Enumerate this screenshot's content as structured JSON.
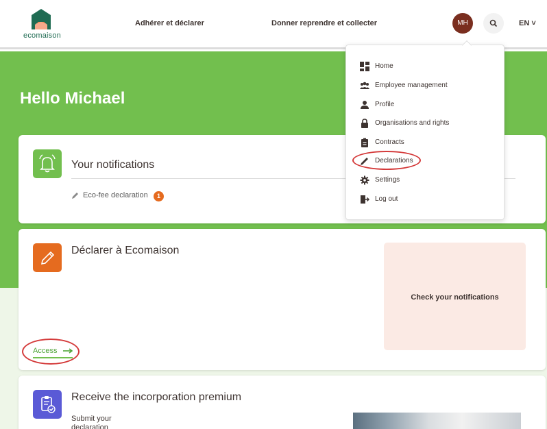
{
  "header": {
    "logo_text": "ecomaison",
    "nav": [
      "Adhérer et déclarer",
      "Donner reprendre et collecter"
    ],
    "avatar_initials": "MH",
    "language": "EN ˅"
  },
  "hero": {
    "greeting": "Hello Michael"
  },
  "notifications": {
    "title": "Your notifications",
    "item_label": "Eco-fee declaration",
    "item_count": "1"
  },
  "declare": {
    "title": "Déclarer à Ecomaison",
    "panel_text": "Check your notifications",
    "access_label": "Access"
  },
  "premium": {
    "title": "Receive the incorporation premium",
    "text_line1": "Submit your",
    "text_line2": "declaration"
  },
  "menu": {
    "items": [
      {
        "label": "Home",
        "icon": "grid-icon"
      },
      {
        "label": "Employee management",
        "icon": "users-icon"
      },
      {
        "label": "Profile",
        "icon": "user-icon"
      },
      {
        "label": "Organisations and rights",
        "icon": "lock-icon"
      },
      {
        "label": "Contracts",
        "icon": "clipboard-icon"
      },
      {
        "label": "Declarations",
        "icon": "pencil-icon"
      },
      {
        "label": "Settings",
        "icon": "gear-icon"
      },
      {
        "label": "Log out",
        "icon": "logout-icon"
      }
    ]
  },
  "colors": {
    "brand_green": "#72bf4e",
    "logo_green": "#1f6b52",
    "accent_orange": "#e56b1f",
    "accent_purple": "#5a5ad6",
    "avatar_brown": "#7a2e1f",
    "annotation_red": "#d43a3a"
  }
}
